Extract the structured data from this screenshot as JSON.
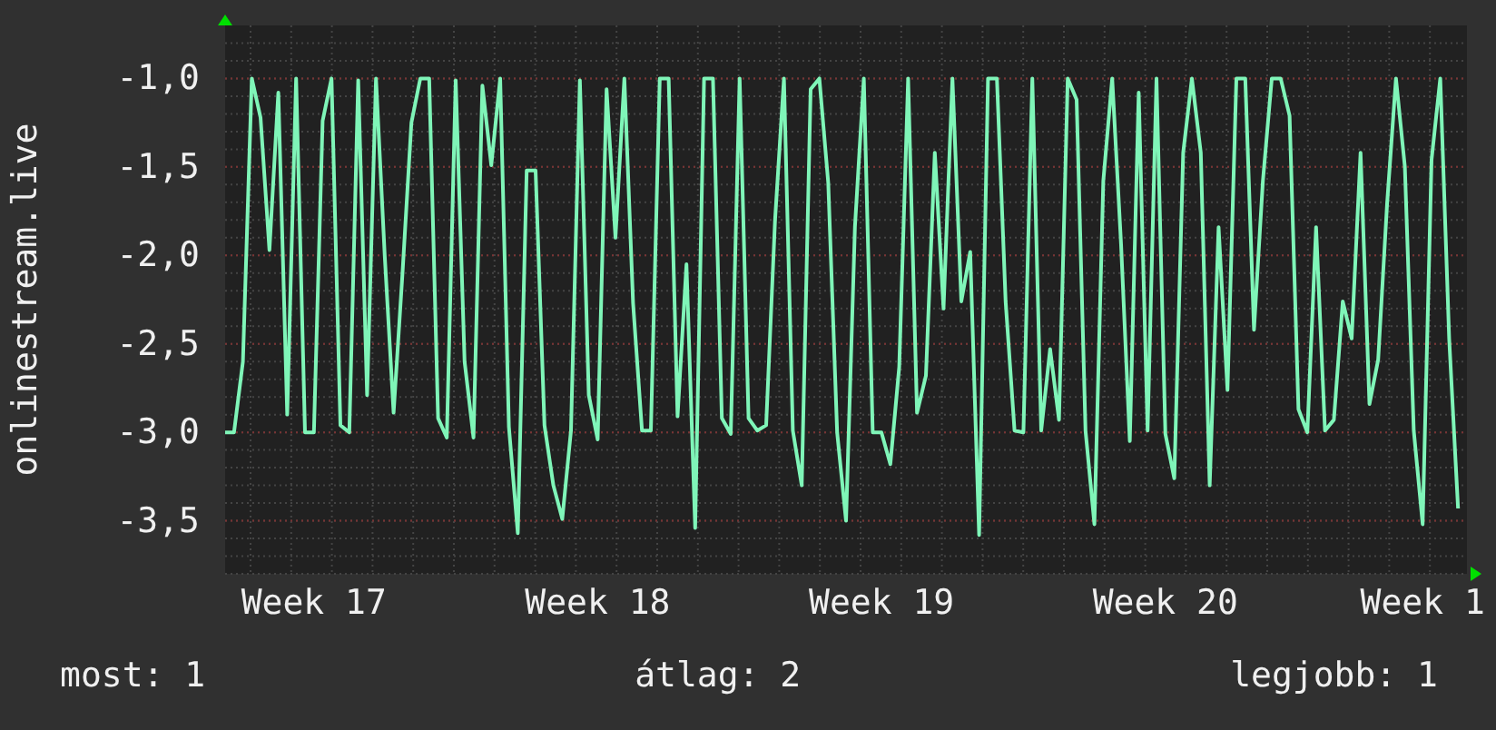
{
  "graph": {
    "chart_data": {
      "type": "line",
      "ylabel": "onlinestream.live",
      "grid": true,
      "categories": [
        null,
        null,
        null,
        null,
        null,
        null,
        null,
        null,
        null,
        null,
        "Week 17",
        null,
        null,
        null,
        null,
        null,
        null,
        null,
        null,
        null,
        null,
        null,
        null,
        null,
        null,
        null,
        null,
        null,
        null,
        null,
        null,
        null,
        null,
        null,
        null,
        null,
        null,
        null,
        null,
        null,
        null,
        null,
        "Week 18",
        null,
        null,
        null,
        null,
        null,
        null,
        null,
        null,
        null,
        null,
        null,
        null,
        null,
        null,
        null,
        null,
        null,
        null,
        null,
        null,
        null,
        null,
        null,
        null,
        null,
        null,
        null,
        null,
        null,
        null,
        null,
        "Week 19",
        null,
        null,
        null,
        null,
        null,
        null,
        null,
        null,
        null,
        null,
        null,
        null,
        null,
        null,
        null,
        null,
        null,
        null,
        null,
        null,
        null,
        null,
        null,
        null,
        null,
        null,
        null,
        null,
        null,
        null,
        null,
        "Week 20",
        null,
        null,
        null,
        null,
        null,
        null,
        null,
        null,
        null,
        null,
        null,
        null,
        null,
        null,
        null,
        null,
        null,
        null,
        null,
        null,
        null,
        null,
        null,
        null,
        null,
        null,
        null,
        null,
        "Week 1",
        null,
        null,
        null,
        null
      ],
      "series": [
        {
          "color": "#7ff5b8",
          "values": [
            -3.0,
            -3.0,
            -2.6,
            -1.0,
            -1.22,
            -1.97,
            -1.08,
            -2.9,
            -1.0,
            -3.0,
            -3.0,
            -1.24,
            -1.0,
            -2.96,
            -3.0,
            -1.01,
            -2.79,
            -1.0,
            -2.0,
            -2.89,
            -2.1,
            -1.25,
            -1.0,
            -1.0,
            -2.92,
            -3.03,
            -1.01,
            -2.6,
            -3.03,
            -1.04,
            -1.49,
            -1.0,
            -2.97,
            -3.57,
            -1.52,
            -1.52,
            -2.96,
            -3.3,
            -3.49,
            -2.99,
            -1.01,
            -2.79,
            -3.04,
            -1.06,
            -1.9,
            -1.0,
            -2.27,
            -2.99,
            -2.99,
            -1.0,
            -1.0,
            -2.91,
            -2.05,
            -3.54,
            -1.0,
            -1.0,
            -2.92,
            -3.01,
            -1.0,
            -2.92,
            -2.99,
            -2.96,
            -1.8,
            -1.0,
            -2.99,
            -3.3,
            -1.06,
            -1.0,
            -1.59,
            -3.0,
            -3.5,
            -1.84,
            -1.0,
            -3.0,
            -3.0,
            -3.18,
            -2.63,
            -1.0,
            -2.89,
            -2.68,
            -1.42,
            -2.3,
            -1.0,
            -2.26,
            -1.98,
            -3.58,
            -1.0,
            -1.0,
            -2.26,
            -2.99,
            -3.0,
            -1.0,
            -2.99,
            -2.53,
            -2.93,
            -1.0,
            -1.12,
            -2.99,
            -3.52,
            -1.58,
            -1.0,
            -1.94,
            -3.05,
            -1.08,
            -2.99,
            -1.0,
            -3.01,
            -3.26,
            -1.42,
            -1.0,
            -1.42,
            -3.3,
            -1.84,
            -2.76,
            -1.0,
            -1.0,
            -2.42,
            -1.58,
            -1.0,
            -1.0,
            -1.21,
            -2.87,
            -3.0,
            -1.84,
            -2.99,
            -2.93,
            -2.26,
            -2.47,
            -1.42,
            -2.84,
            -2.59,
            -1.71,
            -1.0,
            -1.5,
            -2.99,
            -3.52,
            -1.46,
            -1.0,
            -2.47,
            -3.43
          ]
        }
      ],
      "ylim": [
        -3.8,
        -0.7
      ],
      "yticks": [
        {
          "value": -1.0,
          "label": "-1,0"
        },
        {
          "value": -1.5,
          "label": "-1,5"
        },
        {
          "value": -2.0,
          "label": "-2,0"
        },
        {
          "value": -2.5,
          "label": "-2,5"
        },
        {
          "value": -3.0,
          "label": "-3,0"
        },
        {
          "value": -3.5,
          "label": "-3,5"
        }
      ]
    }
  },
  "legend": [
    {
      "label": "most: 1"
    },
    {
      "label": "átlag: 2"
    },
    {
      "label": "legjobb: 1"
    }
  ]
}
